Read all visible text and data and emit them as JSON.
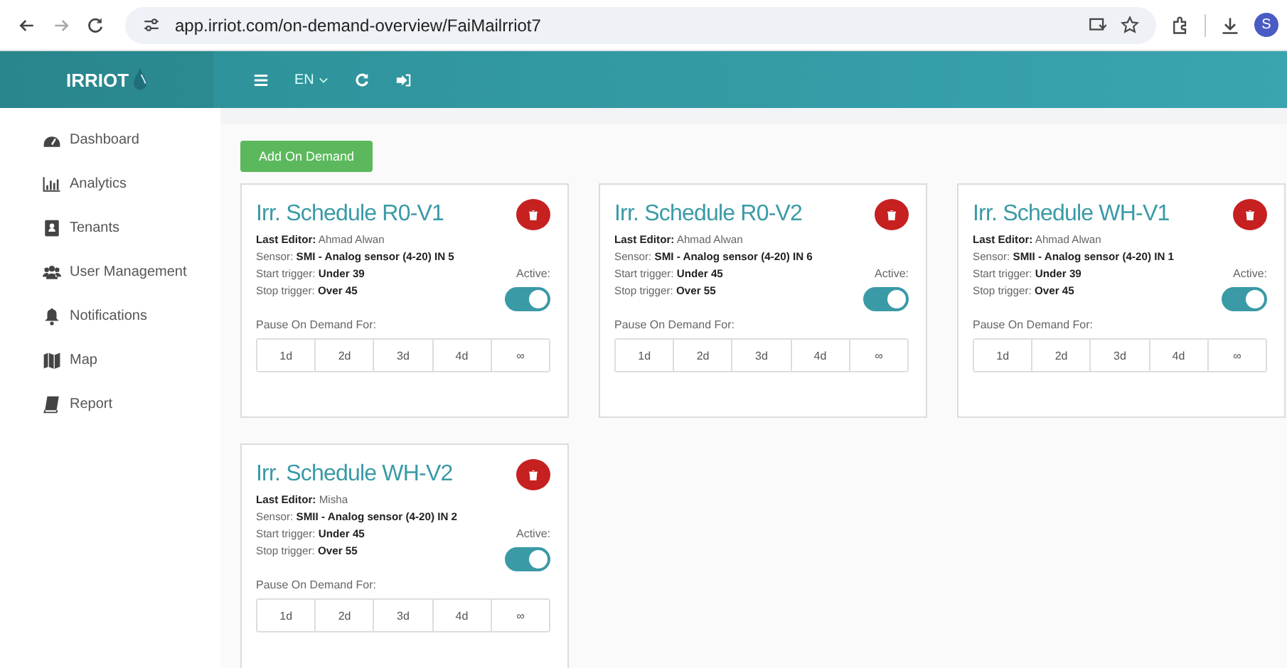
{
  "browser": {
    "url": "app.irriot.com/on-demand-overview/FaiMailrriot7",
    "profile_initial": "S"
  },
  "header": {
    "logo": "IRRIOT",
    "language": "EN"
  },
  "sidebar": {
    "items": [
      {
        "label": "Dashboard",
        "kind": "dashboard"
      },
      {
        "label": "Analytics",
        "kind": "analytics"
      },
      {
        "label": "Tenants",
        "kind": "tenants"
      },
      {
        "label": "User Management",
        "kind": "users"
      },
      {
        "label": "Notifications",
        "kind": "bell"
      },
      {
        "label": "Map",
        "kind": "map"
      },
      {
        "label": "Report",
        "kind": "report"
      }
    ]
  },
  "add_button": "Add On Demand",
  "schedules": [
    {
      "title": "Irr. Schedule R0-V1",
      "lines": [
        "**Last Editor:** Ahmad Alwan",
        "Sensor: **SMI - Analog sensor (4-20) IN 5**",
        "Start trigger: **Under 39**",
        "Stop trigger: **Over 45**"
      ],
      "active_label": "Active:",
      "active": true,
      "pause_label": "Pause On Demand For:",
      "pause_options": [
        "1d",
        "2d",
        "3d",
        "4d",
        "∞"
      ]
    },
    {
      "title": "Irr. Schedule R0-V2",
      "lines": [
        "**Last Editor:** Ahmad Alwan",
        "Sensor: **SMI - Analog sensor (4-20) IN 6**",
        "Start trigger: **Under 45**",
        "Stop trigger: **Over 55**"
      ],
      "active_label": "Active:",
      "active": true,
      "pause_label": "Pause On Demand For:",
      "pause_options": [
        "1d",
        "2d",
        "3d",
        "4d",
        "∞"
      ]
    },
    {
      "title": "Irr. Schedule WH-V1",
      "lines": [
        "**Last Editor:** Ahmad Alwan",
        "Sensor: **SMII - Analog sensor (4-20) IN 1**",
        "Start trigger: **Under 39**",
        "Stop trigger: **Over 45**"
      ],
      "active_label": "Active:",
      "active": true,
      "pause_label": "Pause On Demand For:",
      "pause_options": [
        "1d",
        "2d",
        "3d",
        "4d",
        "∞"
      ]
    },
    {
      "title": "Irr. Schedule WH-V2",
      "lines": [
        "**Last Editor:** Misha",
        "Sensor: **SMII - Analog sensor (4-20) IN 2**",
        "Start trigger: **Under 45**",
        "Stop trigger: **Over 55**"
      ],
      "active_label": "Active:",
      "active": true,
      "pause_label": "Pause On Demand For:",
      "pause_options": [
        "1d",
        "2d",
        "3d",
        "4d",
        "∞"
      ]
    }
  ]
}
